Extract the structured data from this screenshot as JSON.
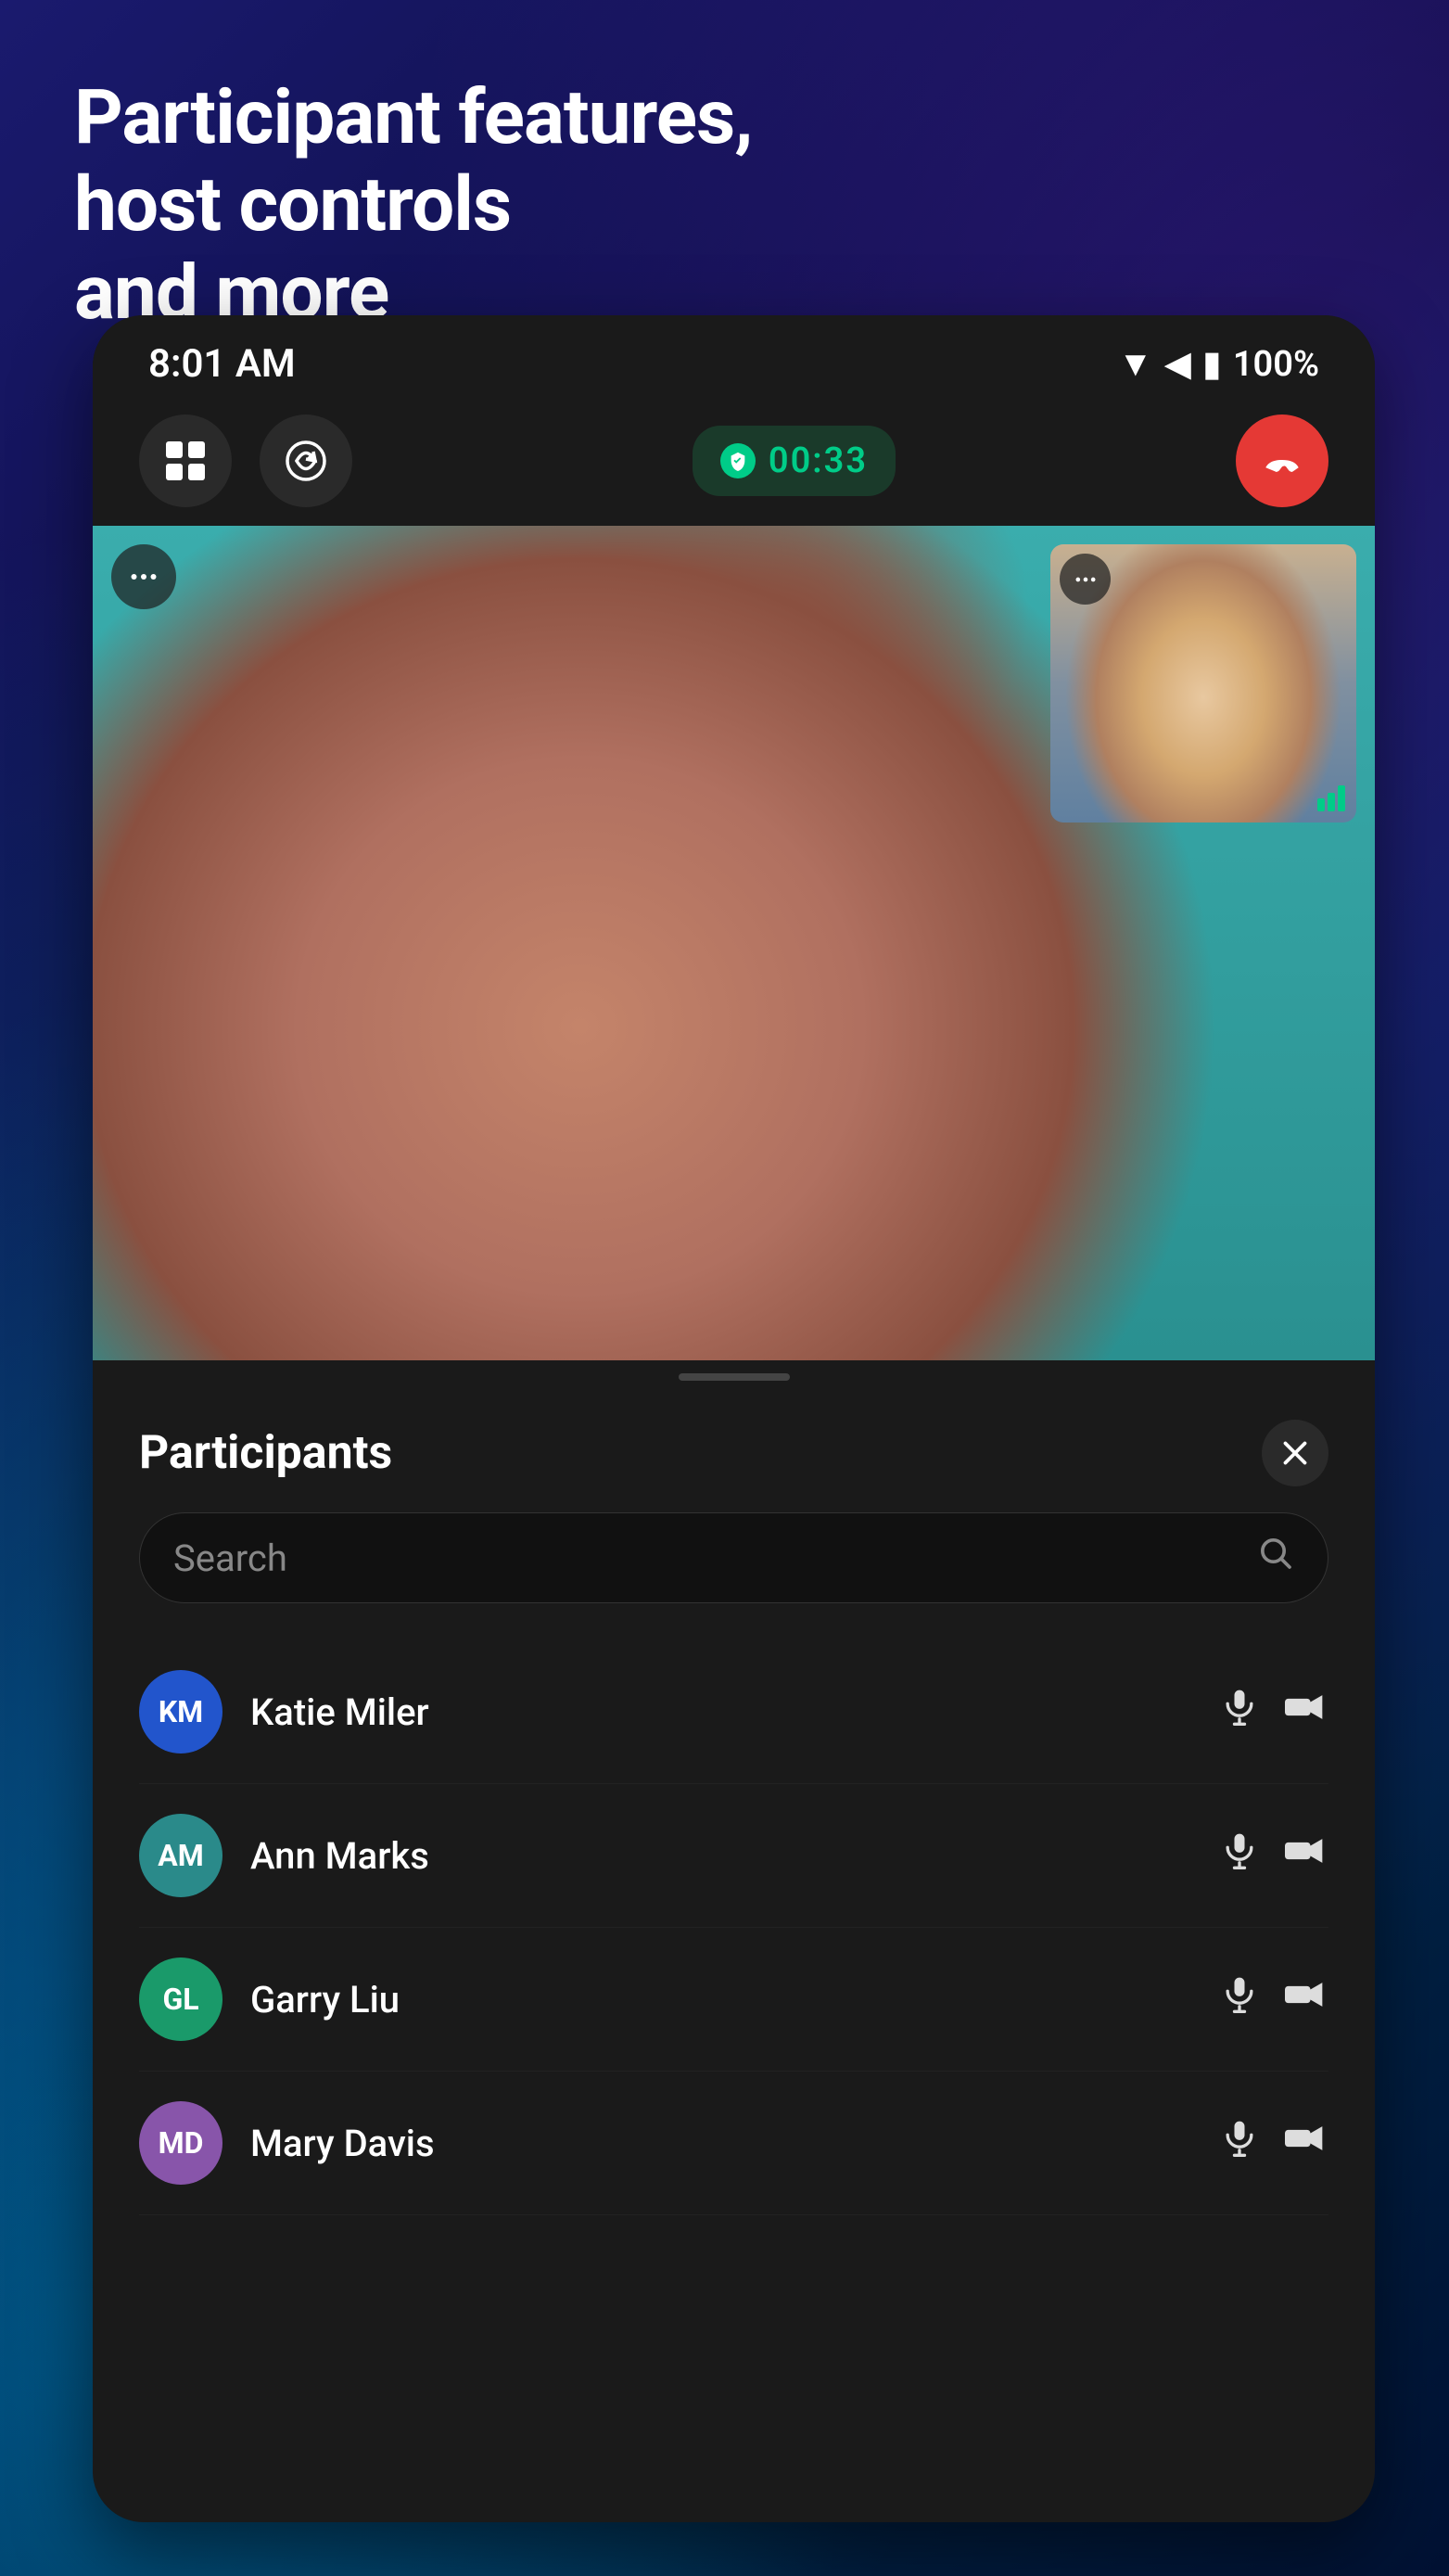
{
  "headline": {
    "line1": "Participant features,",
    "line2": "host controls",
    "line3": "and more"
  },
  "statusBar": {
    "time": "8:01 AM",
    "battery": "100%"
  },
  "toolbar": {
    "timerLabel": "00:33"
  },
  "participants": {
    "title": "Participants",
    "closeLabel": "×",
    "search": {
      "placeholder": "Search"
    },
    "list": [
      {
        "id": "km",
        "initials": "KM",
        "name": "Katie Miler",
        "avatarColor": "#2255cc",
        "hasMic": true,
        "hasCam": true
      },
      {
        "id": "am",
        "initials": "AM",
        "name": "Ann Marks",
        "avatarColor": "#2a8a8a",
        "hasMic": true,
        "hasCam": true
      },
      {
        "id": "gl",
        "initials": "GL",
        "name": "Garry Liu",
        "avatarColor": "#1a9a6a",
        "hasMic": true,
        "hasCam": true
      },
      {
        "id": "md",
        "initials": "MD",
        "name": "Mary Davis",
        "avatarColor": "#8855aa",
        "hasMic": true,
        "hasCam": true
      }
    ]
  },
  "colors": {
    "accent": "#00cc88",
    "endCall": "#e53935",
    "dark": "#1a1a1a"
  }
}
